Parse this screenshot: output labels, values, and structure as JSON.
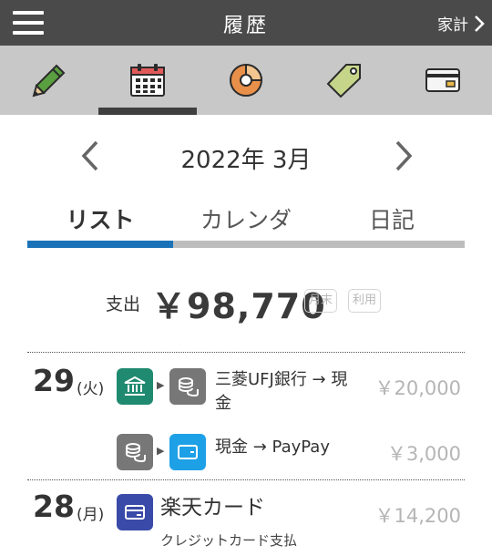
{
  "header": {
    "title": "履歴",
    "right_link": "家計"
  },
  "icon_tabs": [
    {
      "name": "pencil-icon"
    },
    {
      "name": "calendar-icon"
    },
    {
      "name": "pie-chart-icon"
    },
    {
      "name": "tag-icon"
    },
    {
      "name": "card-icon"
    }
  ],
  "month_nav": {
    "label": "2022年 3月"
  },
  "subtabs": {
    "list": "リスト",
    "calendar": "カレンダ",
    "diary": "日記",
    "active": "list"
  },
  "summary": {
    "label": "支出",
    "amount": "￥98,770",
    "badge_month_end": "月末",
    "badge_usage": "利用"
  },
  "entries": [
    {
      "day": "29",
      "dow": "(火)",
      "items": [
        {
          "from_icon": "bank-icon",
          "to_icon": "coins-icon",
          "text_line1": "三菱UFJ銀行 → 現",
          "text_line2": "金",
          "amount": "￥20,000"
        },
        {
          "from_icon": "coins-icon",
          "to_icon": "wallet-icon",
          "text_line1": "現金 → PayPay",
          "amount": "￥3,000"
        }
      ]
    },
    {
      "day": "28",
      "dow": "(月)",
      "items": [
        {
          "icon": "credit-card-icon",
          "title": "楽天カード",
          "subtitle": "クレジットカード支払",
          "amount": "￥14,200"
        }
      ]
    }
  ],
  "colors": {
    "appbar": "#4a4a4a",
    "iconbar": "#c8c8c8",
    "accent_blue": "#1a73b8",
    "bank_green": "#1f8a70",
    "coins_gray": "#777777",
    "wallet_blue": "#1ea0e6",
    "card_indigo": "#3a4aa8"
  }
}
